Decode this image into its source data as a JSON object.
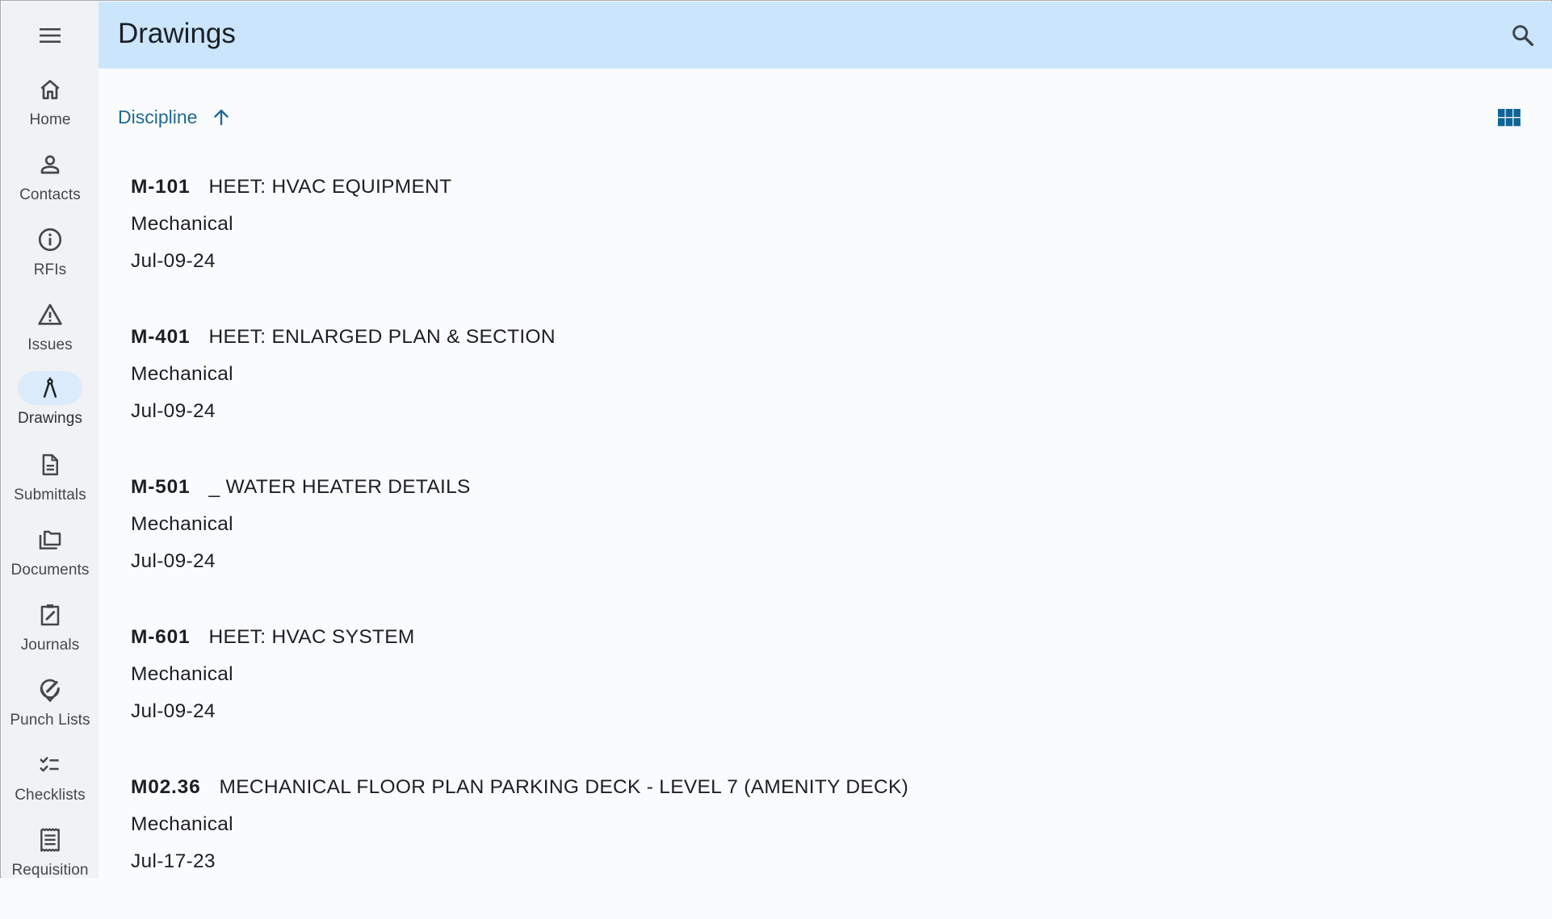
{
  "header": {
    "title": "Drawings",
    "search_icon": "search-icon"
  },
  "sidebar": {
    "menu_icon": "hamburger-menu-icon",
    "items": [
      {
        "label": "Home",
        "icon": "home-icon",
        "active": false
      },
      {
        "label": "Contacts",
        "icon": "person-icon",
        "active": false
      },
      {
        "label": "RFIs",
        "icon": "info-circle-icon",
        "active": false
      },
      {
        "label": "Issues",
        "icon": "warning-triangle-icon",
        "active": false
      },
      {
        "label": "Drawings",
        "icon": "compass-drafting-icon",
        "active": true
      },
      {
        "label": "Submittals",
        "icon": "document-icon",
        "active": false
      },
      {
        "label": "Documents",
        "icon": "folders-icon",
        "active": false
      },
      {
        "label": "Journals",
        "icon": "clipboard-edit-icon",
        "active": false
      },
      {
        "label": "Punch Lists",
        "icon": "pin-edit-icon",
        "active": false
      },
      {
        "label": "Checklists",
        "icon": "checklist-icon",
        "active": false
      },
      {
        "label": "Requisition",
        "icon": "receipt-icon",
        "active": false
      }
    ]
  },
  "toolbar": {
    "sort_label": "Discipline",
    "sort_direction": "ascending",
    "sort_icon": "arrow-up-icon",
    "view_toggle_icon": "grid-view-icon"
  },
  "drawings": [
    {
      "number": "M-101",
      "title": "HEET: HVAC EQUIPMENT",
      "discipline": "Mechanical",
      "date": "Jul-09-24"
    },
    {
      "number": "M-401",
      "title": "HEET: ENLARGED PLAN & SECTION",
      "discipline": "Mechanical",
      "date": "Jul-09-24"
    },
    {
      "number": "M-501",
      "title": "_ WATER HEATER DETAILS",
      "discipline": "Mechanical",
      "date": "Jul-09-24"
    },
    {
      "number": "M-601",
      "title": "HEET: HVAC SYSTEM",
      "discipline": "Mechanical",
      "date": "Jul-09-24"
    },
    {
      "number": "M02.36",
      "title": "MECHANICAL FLOOR PLAN PARKING DECK - LEVEL 7 (AMENITY DECK)",
      "discipline": "Mechanical",
      "date": "Jul-17-23"
    }
  ],
  "colors": {
    "header_bg": "#cbe5fc",
    "sidebar_bg": "#f1f2f4",
    "active_pill": "#dcebfb",
    "accent": "#1e6a94",
    "grid_icon": "#0d6496"
  }
}
